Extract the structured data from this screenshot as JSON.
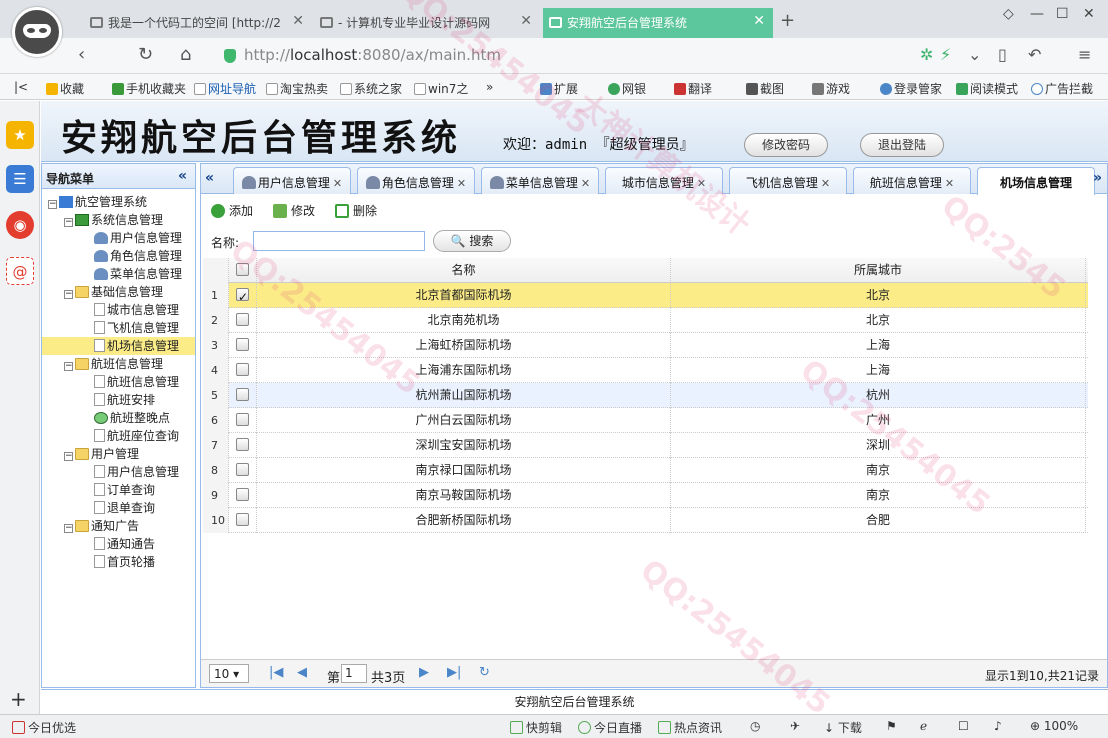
{
  "browser": {
    "tabs": [
      {
        "title": "我是一个代码工的空间 [http://2",
        "active": false
      },
      {
        "title": "- 计算机专业毕业设计源码网",
        "active": false
      },
      {
        "title": "安翔航空后台管理系统",
        "active": true
      }
    ],
    "url_host": "localhost",
    "url_prefix": "http://",
    "url_suffix": ":8080/ax/main.htm",
    "favorites": [
      "收藏",
      "手机收藏夹",
      "网址导航",
      "淘宝热卖",
      "系统之家",
      "win7之",
      "扩展",
      "网银",
      "翻译",
      "截图",
      "游戏",
      "登录管家",
      "阅读模式",
      "广告拦截"
    ]
  },
  "header": {
    "title": "安翔航空后台管理系统",
    "welcome": "欢迎：admin 『超级管理员』",
    "change_password": "修改密码",
    "logout": "退出登陆"
  },
  "nav": {
    "title": "导航菜单",
    "tree": [
      {
        "label": "航空管理系统",
        "level": 0,
        "icon": "home-icon"
      },
      {
        "label": "系统信息管理",
        "level": 1,
        "icon": "system-icon"
      },
      {
        "label": "用户信息管理",
        "level": 2,
        "icon": "user-icon"
      },
      {
        "label": "角色信息管理",
        "level": 2,
        "icon": "role-icon"
      },
      {
        "label": "菜单信息管理",
        "level": 2,
        "icon": "menu-icon"
      },
      {
        "label": "基础信息管理",
        "level": 1,
        "icon": "folder-icon"
      },
      {
        "label": "城市信息管理",
        "level": 2,
        "icon": "page-icon"
      },
      {
        "label": "飞机信息管理",
        "level": 2,
        "icon": "page-icon"
      },
      {
        "label": "机场信息管理",
        "level": 2,
        "icon": "page-icon",
        "selected": true
      },
      {
        "label": "航班信息管理",
        "level": 1,
        "icon": "folder-icon"
      },
      {
        "label": "航班信息管理",
        "level": 2,
        "icon": "page-icon"
      },
      {
        "label": "航班安排",
        "level": 2,
        "icon": "page-icon"
      },
      {
        "label": "航班整晚点",
        "level": 2,
        "icon": "clock-icon"
      },
      {
        "label": "航班座位查询",
        "level": 2,
        "icon": "seat-icon"
      },
      {
        "label": "用户管理",
        "level": 1,
        "icon": "folder-icon"
      },
      {
        "label": "用户信息管理",
        "level": 2,
        "icon": "page-icon"
      },
      {
        "label": "订单查询",
        "level": 2,
        "icon": "page-icon"
      },
      {
        "label": "退单查询",
        "level": 2,
        "icon": "page-icon"
      },
      {
        "label": "通知广告",
        "level": 1,
        "icon": "folder-icon"
      },
      {
        "label": "通知通告",
        "level": 2,
        "icon": "page-icon"
      },
      {
        "label": "首页轮播",
        "level": 2,
        "icon": "carousel-icon"
      }
    ]
  },
  "main_tabs": [
    "用户信息管理",
    "角色信息管理",
    "菜单信息管理",
    "城市信息管理",
    "飞机信息管理",
    "航班信息管理",
    "机场信息管理"
  ],
  "active_tab": "机场信息管理",
  "toolbar": {
    "add": "添加",
    "edit": "修改",
    "delete": "删除"
  },
  "search": {
    "label": "名称:",
    "value": "",
    "button": "搜索"
  },
  "grid": {
    "columns": [
      "名称",
      "所属城市"
    ],
    "rows": [
      {
        "no": "1",
        "name": "北京首都国际机场",
        "city": "北京",
        "checked": true
      },
      {
        "no": "2",
        "name": "北京南苑机场",
        "city": "北京",
        "checked": false
      },
      {
        "no": "3",
        "name": "上海虹桥国际机场",
        "city": "上海",
        "checked": false
      },
      {
        "no": "4",
        "name": "上海浦东国际机场",
        "city": "上海",
        "checked": false
      },
      {
        "no": "5",
        "name": "杭州萧山国际机场",
        "city": "杭州",
        "checked": false
      },
      {
        "no": "6",
        "name": "广州白云国际机场",
        "city": "广州",
        "checked": false
      },
      {
        "no": "7",
        "name": "深圳宝安国际机场",
        "city": "深圳",
        "checked": false
      },
      {
        "no": "8",
        "name": "南京禄口国际机场",
        "city": "南京",
        "checked": false
      },
      {
        "no": "9",
        "name": "南京马鞍国际机场",
        "city": "南京",
        "checked": false
      },
      {
        "no": "10",
        "name": "合肥新桥国际机场",
        "city": "合肥",
        "checked": false
      }
    ]
  },
  "pager": {
    "page_size": "10",
    "page_label": "第",
    "page_value": "1",
    "total_pages": "共3页",
    "info": "显示1到10,共21记录"
  },
  "footer": "安翔航空后台管理系统",
  "statusbar": {
    "left": "今日优选",
    "items": [
      "快剪辑",
      "今日直播",
      "热点资讯",
      "下载",
      "100%"
    ]
  }
}
